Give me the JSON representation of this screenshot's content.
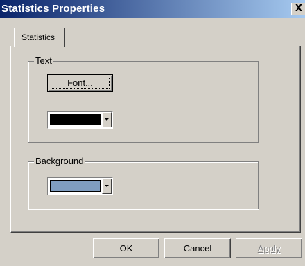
{
  "window": {
    "title": "Statistics Properties",
    "close_glyph": "X"
  },
  "tabs": [
    {
      "label": "Statistics",
      "selected": true
    }
  ],
  "text_group": {
    "label": "Text",
    "font_button": "Font...",
    "color": "#000000"
  },
  "background_group": {
    "label": "Background",
    "color": "#7f9dbf"
  },
  "buttons": {
    "ok": "OK",
    "cancel": "Cancel",
    "apply": "Apply",
    "apply_enabled": false
  },
  "icons": {
    "close": "close-icon",
    "dropdown": "chevron-down-icon"
  }
}
